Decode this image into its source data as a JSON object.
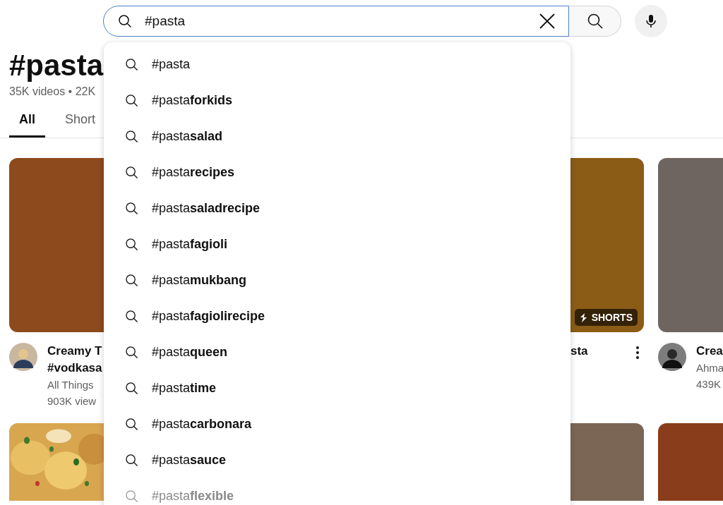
{
  "search": {
    "query": "#pasta"
  },
  "suggestions": [
    {
      "text": "#pasta",
      "dimmed": false
    },
    {
      "text": "#pasta**forkids**",
      "dimmed": false
    },
    {
      "text": "#pasta**salad**",
      "dimmed": false
    },
    {
      "text": "#pasta**recipes**",
      "dimmed": false
    },
    {
      "text": "#pasta**saladrecipe**",
      "dimmed": false
    },
    {
      "text": "#pasta**fagioli**",
      "dimmed": false
    },
    {
      "text": "#pasta**mukbang**",
      "dimmed": false
    },
    {
      "text": "#pasta**fagiolirecipe**",
      "dimmed": false
    },
    {
      "text": "#pasta**queen**",
      "dimmed": false
    },
    {
      "text": "#pasta**time**",
      "dimmed": false
    },
    {
      "text": "#pasta**carbonara**",
      "dimmed": false
    },
    {
      "text": "#pasta**sauce**",
      "dimmed": false
    },
    {
      "text": "#pasta**flexible**",
      "dimmed": true
    }
  ],
  "page": {
    "title": "#pasta",
    "stats": "35K videos • 22K"
  },
  "tabs": [
    {
      "label": "All",
      "selected": true
    },
    {
      "label": "Short",
      "selected": false
    }
  ],
  "videos": [
    {
      "color": "#8d4a1d",
      "avatar": true,
      "title": [
        "Creamy T",
        "#vodkasa"
      ],
      "channel": "All Things",
      "views": "903K view"
    },
    {
      "color": "#8b5c16",
      "badge": "SHORTS",
      "menu": true,
      "title": [
        "sta"
      ]
    },
    {
      "color": "#6f6560",
      "avatar": true,
      "title": [
        "Crea"
      ],
      "channel": "Ahma",
      "views": "439K"
    }
  ],
  "more_videos": [
    {
      "kind": "picture"
    },
    {
      "kind": "plain",
      "color": "#7b6656"
    },
    {
      "kind": "plain",
      "color": "#8a3d1a"
    }
  ]
}
